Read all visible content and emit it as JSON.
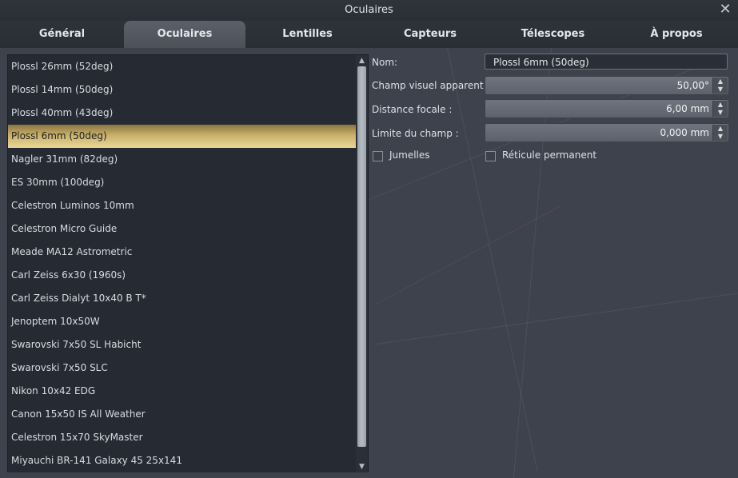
{
  "window": {
    "title": "Oculaires"
  },
  "tabs": [
    {
      "label": "Général"
    },
    {
      "label": "Oculaires"
    },
    {
      "label": "Lentilles"
    },
    {
      "label": "Capteurs"
    },
    {
      "label": "Télescopes"
    },
    {
      "label": "À propos"
    }
  ],
  "active_tab": "Oculaires",
  "eyepieces": [
    "Plossl 26mm (52deg)",
    "Plossl 14mm (50deg)",
    "Plossl 40mm (43deg)",
    "Plossl 6mm (50deg)",
    "Nagler 31mm (82deg)",
    "ES 30mm (100deg)",
    "Celestron Luminos 10mm",
    "Celestron Micro Guide",
    "Meade MA12 Astrometric",
    "Carl Zeiss 6x30 (1960s)",
    "Carl Zeiss Dialyt 10x40 B T*",
    "Jenoptem 10x50W",
    "Swarovski 7x50 SL Habicht",
    "Swarovski 7x50 SLC",
    "Nikon 10x42 EDG",
    "Canon 15x50 IS All Weather",
    "Celestron 15x70 SkyMaster",
    "Miyauchi BR-141 Galaxy 45 25x141"
  ],
  "selected_eyepiece": "Plossl 6mm (50deg)",
  "form": {
    "name_label": "Nom:",
    "name_value": "Plossl 6mm (50deg)",
    "fov_label": "Champ visuel apparent :",
    "fov_value": "50,00°",
    "focal_label": "Distance focale :",
    "focal_value": "6,00 mm",
    "fieldstop_label": "Limite du champ :",
    "fieldstop_value": "0,000 mm",
    "binoculars_label": "Jumelles",
    "binoculars_checked": false,
    "reticle_label": "Réticule permanent",
    "reticle_checked": false
  },
  "colors": {
    "background": "#3d424c",
    "list_bg": "#252a33",
    "selection_gold": "#c9b06a"
  }
}
